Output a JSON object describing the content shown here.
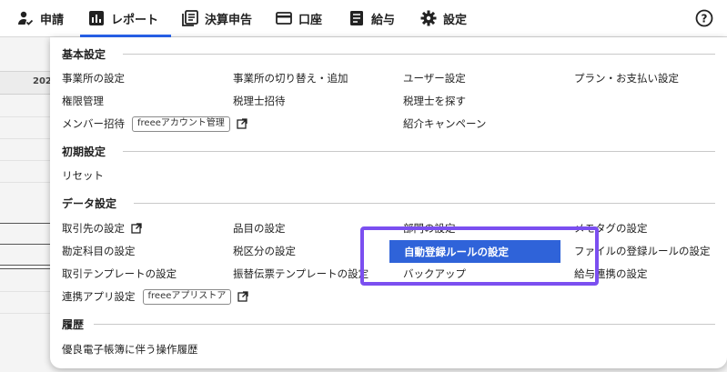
{
  "nav": {
    "items": [
      {
        "label": "申請",
        "icon": "person-check-icon"
      },
      {
        "label": "レポート",
        "icon": "report-chart-icon"
      },
      {
        "label": "決算申告",
        "icon": "document-stack-icon"
      },
      {
        "label": "口座",
        "icon": "credit-card-icon"
      },
      {
        "label": "給与",
        "icon": "payroll-icon"
      },
      {
        "label": "設定",
        "icon": "gear-icon"
      }
    ],
    "active": "レポート",
    "help_label": "?"
  },
  "background": {
    "year_text": "202"
  },
  "menu": {
    "sections": {
      "basic": "基本設定",
      "initial": "初期設定",
      "data": "データ設定",
      "history": "履歴"
    },
    "basic": {
      "office_settings": "事業所の設定",
      "switch_office": "事業所の切り替え・追加",
      "user_settings": "ユーザー設定",
      "plan_payment": "プラン・お支払い設定",
      "permission": "権限管理",
      "accountant_invite": "税理士招待",
      "find_accountant": "税理士を探す",
      "invite_member": "メンバー招待",
      "account_manage_tag": "freeeアカウント管理",
      "referral": "紹介キャンペーン"
    },
    "initial": {
      "reset": "リセット"
    },
    "data": {
      "partners": "取引先の設定",
      "items": "品目の設定",
      "departments": "部門の設定",
      "memo_tags": "メモタグの設定",
      "accounts": "勘定科目の設定",
      "tax_categories": "税区分の設定",
      "auto_rules": "自動登録ルールの設定",
      "file_rules": "ファイルの登録ルールの設定",
      "deal_templates": "取引テンプレートの設定",
      "transfer_templates": "振替伝票テンプレートの設定",
      "backup": "バックアップ",
      "payroll_link": "給与連携の設定",
      "app_link": "連携アプリ設定",
      "app_store_tag": "freeeアプリストア"
    },
    "history": {
      "ebook_history": "優良電子帳簿に伴う操作履歴"
    }
  },
  "colors": {
    "accent": "#2864f0",
    "highlight": "#2f63d9",
    "annotation": "#7b4ff0"
  }
}
